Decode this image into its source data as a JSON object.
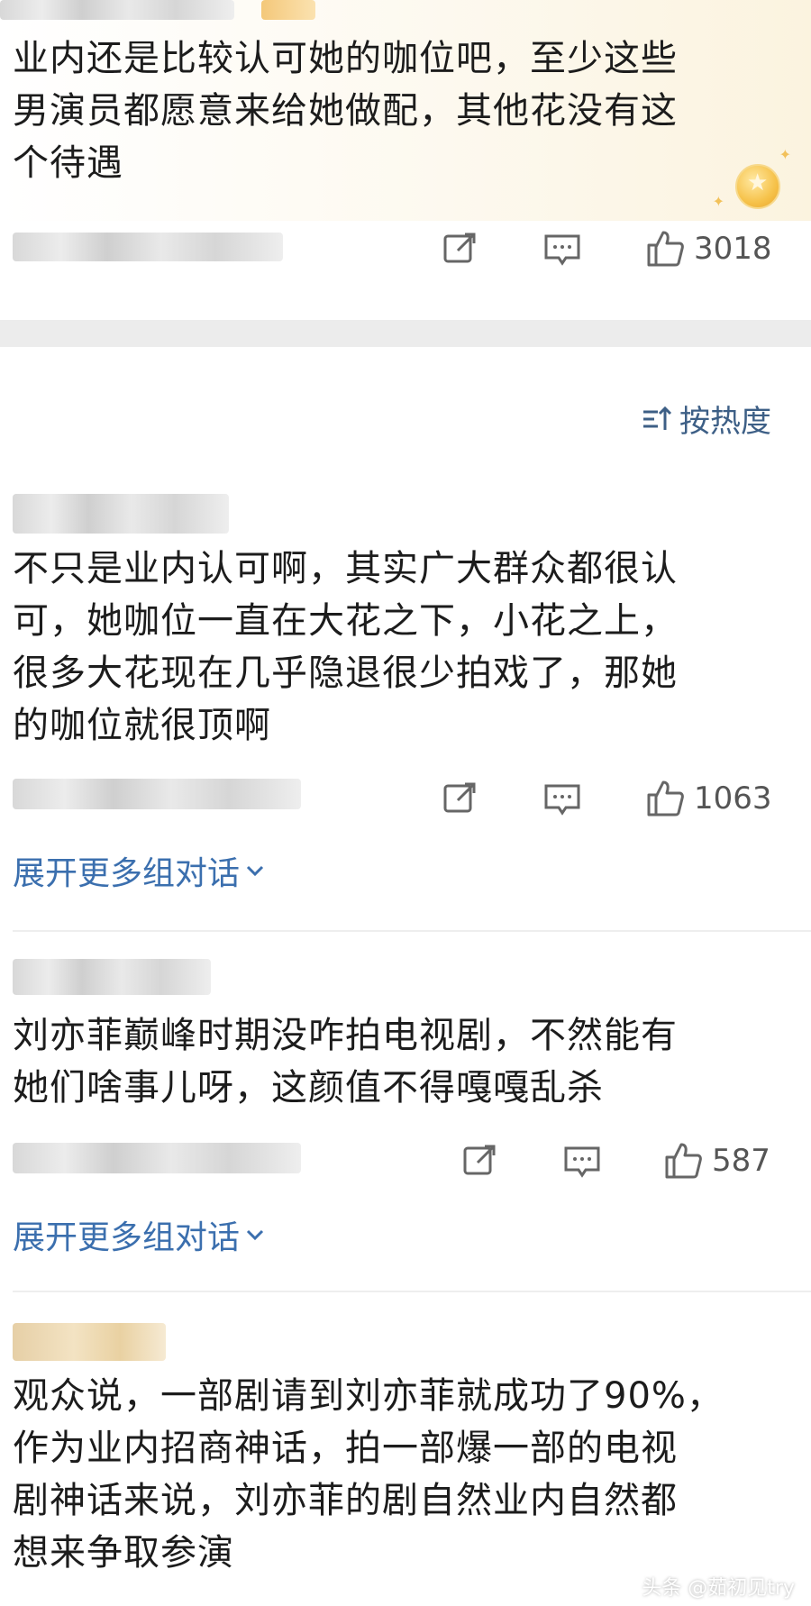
{
  "comments": [
    {
      "text_lines": [
        "业内还是比较认可她的咖位吧，至少这些",
        "男演员都愿意来给她做配，其他花没有这",
        "个待遇"
      ],
      "likes": "3018"
    },
    {
      "text_lines": [
        "不只是业内认可啊，其实广大群众都很认",
        "可，她咖位一直在大花之下，小花之上，",
        "很多大花现在几乎隐退很少拍戏了，那她",
        "的咖位就很顶啊"
      ],
      "likes": "1063",
      "expand_label": "展开更多组对话"
    },
    {
      "text_lines": [
        "刘亦菲巅峰时期没咋拍电视剧，不然能有",
        "她们啥事儿呀，这颜值不得嘎嘎乱杀"
      ],
      "likes": "587",
      "expand_label": "展开更多组对话"
    },
    {
      "text_lines": [
        "观众说，一部剧请到刘亦菲就成功了90%，",
        "作为业内招商神话，拍一部爆一部的电视",
        "剧神话来说，刘亦菲的剧自然业内自然都",
        "想来争取参演"
      ]
    }
  ],
  "sort": {
    "label": "按热度"
  },
  "watermark": "头条 @茹初见try",
  "icons": {
    "repost": "repost-icon",
    "comment": "comment-icon",
    "like": "thumbs-up-icon",
    "sort": "sort-icon",
    "chevron": "chevron-down-icon"
  },
  "colors": {
    "link": "#3b6fae",
    "sort": "#3d5f86",
    "count": "#555555",
    "featured_bg": "#fbf3df"
  }
}
